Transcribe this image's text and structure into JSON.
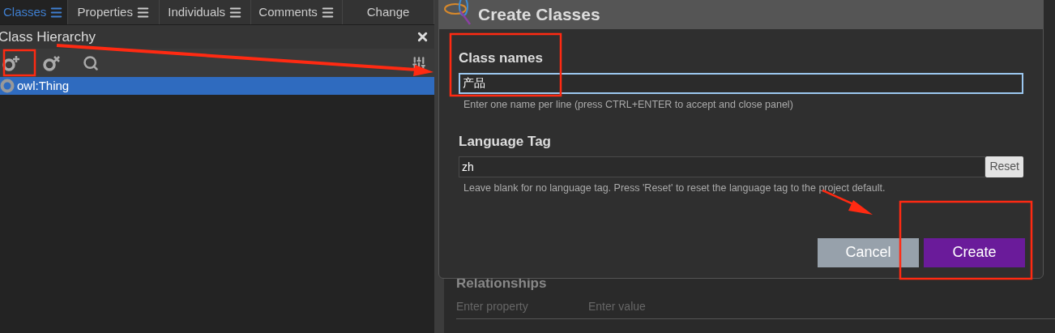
{
  "tabs": [
    {
      "label": "Classes",
      "selected": true
    },
    {
      "label": "Properties",
      "selected": false
    },
    {
      "label": "Individuals",
      "selected": false
    },
    {
      "label": "Comments",
      "selected": false
    },
    {
      "label": "Change",
      "selected": false
    }
  ],
  "class_hierarchy": {
    "title": "Class Hierarchy",
    "items": [
      {
        "label": "owl:Thing",
        "selected": true
      }
    ]
  },
  "background_form": {
    "heading": "Relationships",
    "property_placeholder": "Enter property",
    "value_placeholder": "Enter value"
  },
  "dialog": {
    "title": "Create Classes",
    "class_names": {
      "label": "Class names",
      "value": "产品",
      "hint": "Enter one name per line (press CTRL+ENTER to accept and close panel)"
    },
    "language_tag": {
      "label": "Language Tag",
      "value": "zh",
      "reset": "Reset",
      "hint": "Leave blank for no language tag. Press 'Reset' to reset the language tag to the project default."
    },
    "buttons": [
      {
        "label": "Cancel",
        "kind": "secondary"
      },
      {
        "label": "Create",
        "kind": "primary"
      }
    ]
  }
}
